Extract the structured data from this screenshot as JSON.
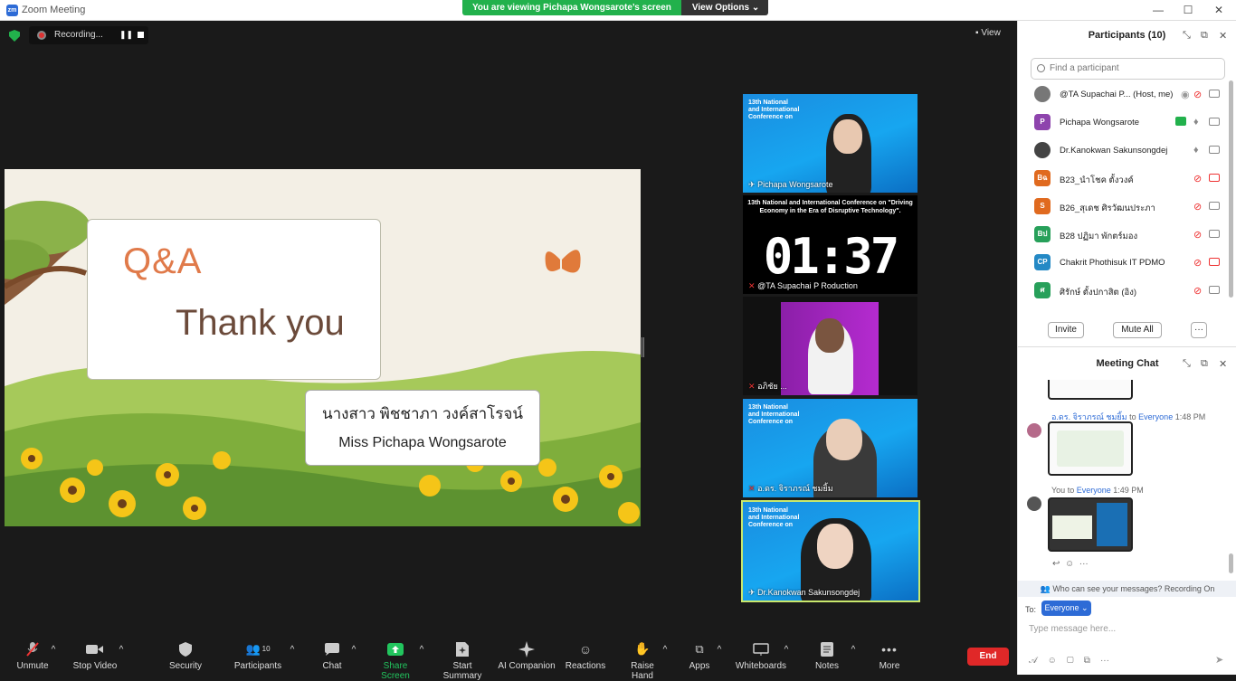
{
  "window": {
    "title": "Zoom Meeting",
    "min": "—",
    "max": "☐",
    "close": "✕"
  },
  "share_banner": {
    "message": "You are viewing Pichapa Wongsarote’s screen",
    "options": "View Options"
  },
  "recording": {
    "label": "Recording..."
  },
  "view_button": {
    "label": "View"
  },
  "slide": {
    "qa": "Q&A",
    "thanks": "Thank you",
    "name_thai": "นางสาว พิชชาภา วงค์สาโรจน์",
    "name_en": "Miss Pichapa Wongsarote"
  },
  "tiles": [
    {
      "label": "Pichapa Wongsarote"
    },
    {
      "label": "@TA Supachai P Roduction",
      "timer": "01:37",
      "banner": "13th National and International Conference on \"Driving Economy in the Era of Disruptive Technology\"."
    },
    {
      "label": "อภิชัย ..."
    },
    {
      "label": "อ.ดร. จิราภรณ์ ชมยิ้ม"
    },
    {
      "label": "Dr.Kanokwan Sakunsongdej"
    }
  ],
  "toolbar": {
    "unmute": "Unmute",
    "stop_video": "Stop Video",
    "security": "Security",
    "participants": "Participants",
    "participants_count": "10",
    "chat": "Chat",
    "share_screen": "Share Screen",
    "start_summary": "Start Summary",
    "ai_companion": "AI Companion",
    "reactions": "Reactions",
    "raise_hand": "Raise Hand",
    "apps": "Apps",
    "whiteboards": "Whiteboards",
    "notes": "Notes",
    "more": "More",
    "end": "End"
  },
  "participants": {
    "title": "Participants (10)",
    "search_placeholder": "Find a participant",
    "list": [
      {
        "name": "@TA Supachai P... (Host, me)",
        "initials": "",
        "color": "#555555"
      },
      {
        "name": "Pichapa Wongsarote",
        "initials": "P",
        "color": "#8e44ad"
      },
      {
        "name": "Dr.Kanokwan Sakunsongdej",
        "initials": "",
        "color": "#444444"
      },
      {
        "name": "B23_นำโชค ตั้งวงค์",
        "initials": "Bฉ",
        "color": "#e06a1f"
      },
      {
        "name": "B26_สุเดช ศิรวัฒนประภา",
        "initials": "S",
        "color": "#e06a1f"
      },
      {
        "name": "B28 ปฏิมา พักตร์มอง",
        "initials": "Bป",
        "color": "#27a05a"
      },
      {
        "name": "Chakrit Phothisuk IT PDMO",
        "initials": "CP",
        "color": "#2489c5"
      },
      {
        "name": "ศิรักษ์ ตั้งปกาสิต (อิง)",
        "initials": "ศ",
        "color": "#27a05a"
      }
    ],
    "invite": "Invite",
    "mute_all": "Mute All",
    "more": "···"
  },
  "chat": {
    "title": "Meeting Chat",
    "msg1_sender": "อ.ดร. จิราภรณ์ ชมยิ้ม",
    "msg1_to": "to",
    "msg1_recipient": "Everyone",
    "msg1_time": "1:48 PM",
    "msg2_sender": "You",
    "msg2_to": "to",
    "msg2_recipient": "Everyone",
    "msg2_time": "1:49 PM",
    "notice": "Who can see your messages? Recording On",
    "to_label": "To:",
    "recipient": "Everyone",
    "placeholder": "Type message here..."
  }
}
